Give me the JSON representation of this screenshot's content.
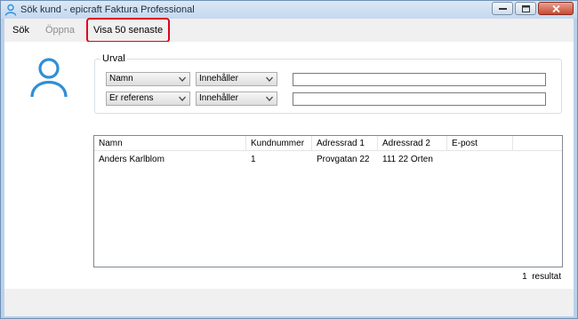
{
  "window": {
    "title": "Sök kund - epicraft Faktura Professional"
  },
  "menu": {
    "sok": "Sök",
    "oppna": "Öppna",
    "visa50": "Visa 50 senaste"
  },
  "filter": {
    "group_label": "Urval",
    "rows": [
      {
        "field": "Namn",
        "operator": "Innehåller",
        "value": ""
      },
      {
        "field": "Er referens",
        "operator": "Innehåller",
        "value": ""
      }
    ]
  },
  "results": {
    "columns": [
      "Namn",
      "Kundnummer",
      "Adressrad 1",
      "Adressrad 2",
      "E-post"
    ],
    "rows": [
      [
        "Anders Karlblom",
        "1",
        "Provgatan 22",
        "111 22 Orten",
        ""
      ]
    ],
    "count": "1",
    "count_label": "resultat"
  },
  "icons": {
    "app": "user-icon",
    "avatar": "user-avatar-icon"
  },
  "colors": {
    "accent": "#2f8fd8",
    "highlight": "#e2001a"
  }
}
